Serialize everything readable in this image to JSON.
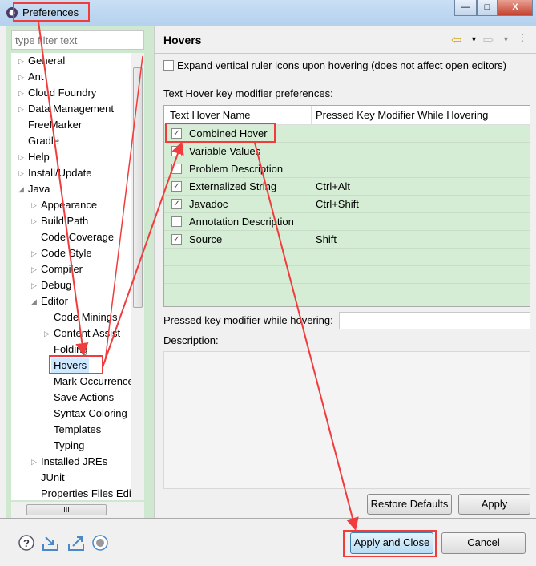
{
  "window": {
    "title": "Preferences",
    "controls": [
      "—",
      "□",
      "X"
    ]
  },
  "filter": {
    "placeholder": "type filter text"
  },
  "tree": [
    {
      "label": "General",
      "level": 0,
      "arrow": true
    },
    {
      "label": "Ant",
      "level": 0,
      "arrow": true
    },
    {
      "label": "Cloud Foundry",
      "level": 0,
      "arrow": true
    },
    {
      "label": "Data Management",
      "level": 0,
      "arrow": true
    },
    {
      "label": "FreeMarker",
      "level": 0,
      "arrow": false
    },
    {
      "label": "Gradle",
      "level": 0,
      "arrow": false
    },
    {
      "label": "Help",
      "level": 0,
      "arrow": true
    },
    {
      "label": "Install/Update",
      "level": 0,
      "arrow": true
    },
    {
      "label": "Java",
      "level": 0,
      "arrow": "open"
    },
    {
      "label": "Appearance",
      "level": 1,
      "arrow": true
    },
    {
      "label": "Build Path",
      "level": 1,
      "arrow": true
    },
    {
      "label": "Code Coverage",
      "level": 1,
      "arrow": false
    },
    {
      "label": "Code Style",
      "level": 1,
      "arrow": true
    },
    {
      "label": "Compiler",
      "level": 1,
      "arrow": true
    },
    {
      "label": "Debug",
      "level": 1,
      "arrow": true
    },
    {
      "label": "Editor",
      "level": 1,
      "arrow": "open"
    },
    {
      "label": "Code Minings",
      "level": 2,
      "arrow": false
    },
    {
      "label": "Content Assist",
      "level": 2,
      "arrow": true
    },
    {
      "label": "Folding",
      "level": 2,
      "arrow": false
    },
    {
      "label": "Hovers",
      "level": 2,
      "arrow": false,
      "selected": true
    },
    {
      "label": "Mark Occurrences",
      "level": 2,
      "arrow": false
    },
    {
      "label": "Save Actions",
      "level": 2,
      "arrow": false
    },
    {
      "label": "Syntax Coloring",
      "level": 2,
      "arrow": false
    },
    {
      "label": "Templates",
      "level": 2,
      "arrow": false
    },
    {
      "label": "Typing",
      "level": 2,
      "arrow": false
    },
    {
      "label": "Installed JREs",
      "level": 1,
      "arrow": true
    },
    {
      "label": "JUnit",
      "level": 1,
      "arrow": false
    },
    {
      "label": "Properties Files Editor",
      "level": 1,
      "arrow": false
    }
  ],
  "page": {
    "title": "Hovers",
    "expand_label": "Expand vertical ruler icons upon hovering (does not affect open editors)",
    "expand_checked": false,
    "table_label": "Text Hover key modifier preferences:",
    "columns": [
      "Text Hover Name",
      "Pressed Key Modifier While Hovering"
    ],
    "rows": [
      {
        "name": "Combined Hover",
        "checked": true,
        "modifier": ""
      },
      {
        "name": "Variable Values",
        "checked": false,
        "modifier": ""
      },
      {
        "name": "Problem Description",
        "checked": false,
        "modifier": ""
      },
      {
        "name": "Externalized String",
        "checked": true,
        "modifier": "Ctrl+Alt"
      },
      {
        "name": "Javadoc",
        "checked": true,
        "modifier": "Ctrl+Shift"
      },
      {
        "name": "Annotation Description",
        "checked": false,
        "modifier": ""
      },
      {
        "name": "Source",
        "checked": true,
        "modifier": "Shift"
      }
    ],
    "modifier_label": "Pressed key modifier while hovering:",
    "modifier_value": "",
    "description_label": "Description:",
    "restore_defaults": "Restore Defaults",
    "apply": "Apply"
  },
  "footer": {
    "apply_close": "Apply and Close",
    "cancel": "Cancel",
    "icons": [
      "help-icon",
      "import-icon",
      "export-icon",
      "record-icon"
    ]
  },
  "colors": {
    "annotation": "#f03c3c",
    "panel_green": "#cfe8d0",
    "table_green": "#d5edd5"
  }
}
